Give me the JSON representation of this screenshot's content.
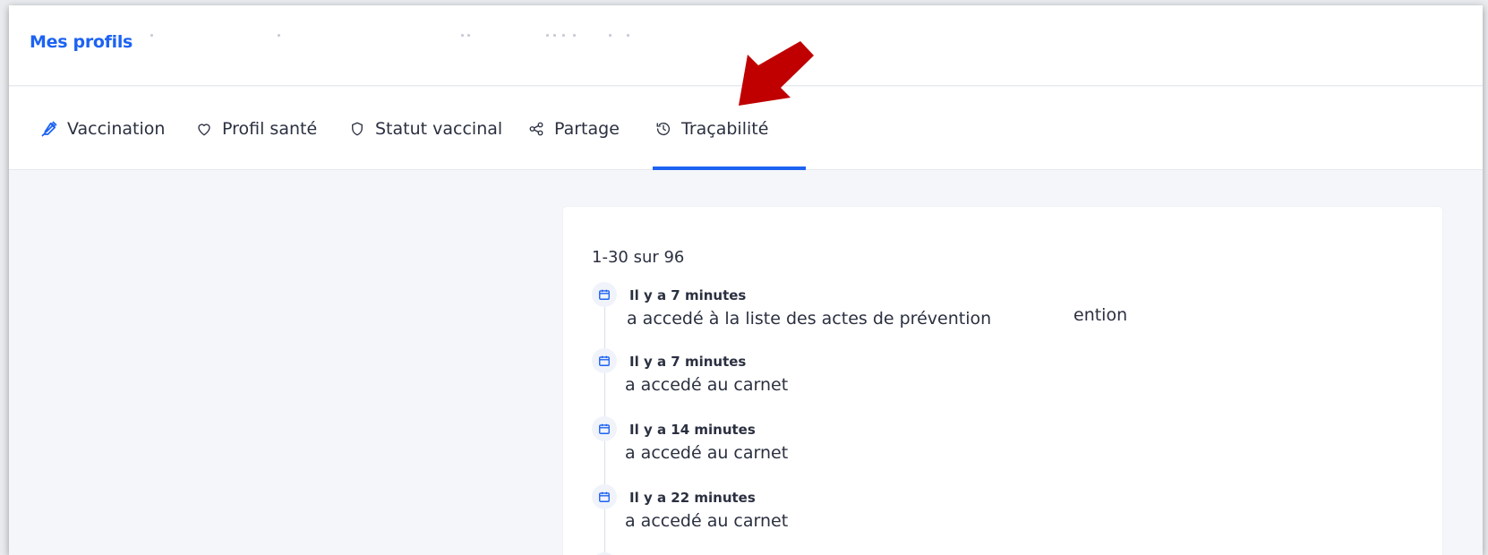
{
  "header": {
    "brand": "Mes profils"
  },
  "tabs": [
    {
      "label": "Vaccination",
      "icon": "syringe-icon"
    },
    {
      "label": "Profil santé",
      "icon": "heart-icon"
    },
    {
      "label": "Statut vaccinal",
      "icon": "shield-icon"
    },
    {
      "label": "Partage",
      "icon": "share-icon"
    },
    {
      "label": "Traçabilité",
      "icon": "history-icon",
      "active": true
    }
  ],
  "history": {
    "count_label": "1-30 sur 96",
    "ghost_fragment": "ention",
    "entries": [
      {
        "time": "Il y a 7 minutes",
        "text": "a accedé à la liste des actes de prévention",
        "icon": "calendar-icon"
      },
      {
        "time": "Il y a 7 minutes",
        "text": "a accedé au carnet",
        "icon": "calendar-icon"
      },
      {
        "time": "Il y a 14 minutes",
        "text": "a accedé au carnet",
        "icon": "calendar-icon"
      },
      {
        "time": "Il y a 22 minutes",
        "text": "a accedé au carnet",
        "icon": "calendar-icon"
      }
    ]
  },
  "colors": {
    "accent": "#1d63f2",
    "arrow": "#c00000",
    "text": "#2b3040",
    "background": "#f5f6fa"
  }
}
